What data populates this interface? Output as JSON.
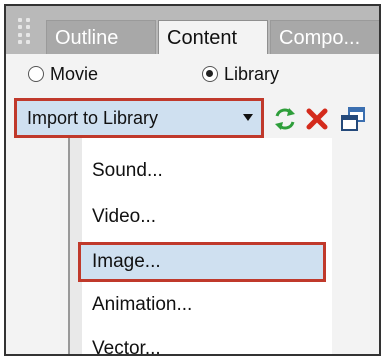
{
  "tabs": [
    {
      "label": "Outline",
      "active": false
    },
    {
      "label": "Content",
      "active": true
    },
    {
      "label": "Compo...",
      "active": false
    }
  ],
  "source_options": [
    {
      "label": "Movie",
      "selected": false
    },
    {
      "label": "Library",
      "selected": true
    }
  ],
  "toolbar": {
    "import_select_value": "Import to Library",
    "icons": [
      "refresh-icon",
      "delete-icon",
      "copy-icon"
    ]
  },
  "dropdown": {
    "items": [
      {
        "label": "Sound..."
      },
      {
        "label": "Video..."
      },
      {
        "label": "Image...",
        "highlighted": true
      },
      {
        "label": "Animation..."
      },
      {
        "label": "Vector..."
      }
    ]
  },
  "colors": {
    "tab_strip_bg": "#b9b9b9",
    "highlight_bg": "#cfe0f0",
    "highlight_border": "#c0392b",
    "refresh_icon": "#2e9e3a",
    "delete_icon": "#d42a1b",
    "copy_icon": "#3b6fb0"
  }
}
